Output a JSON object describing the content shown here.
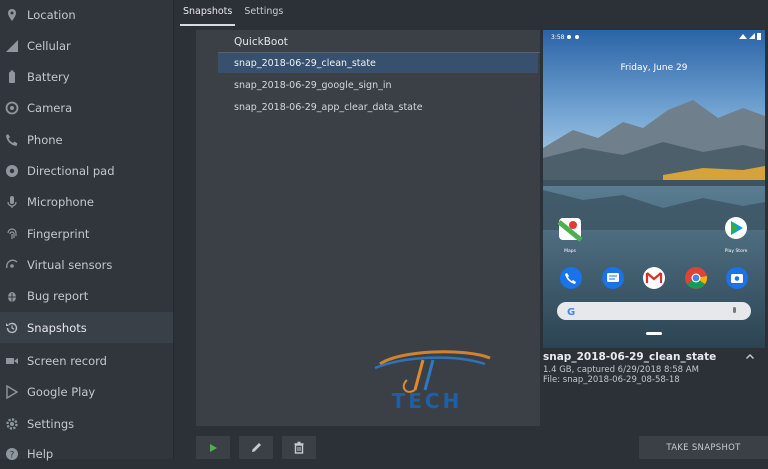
{
  "sidebar": {
    "items": [
      {
        "label": "Location",
        "icon": "location-icon"
      },
      {
        "label": "Cellular",
        "icon": "signal-icon"
      },
      {
        "label": "Battery",
        "icon": "battery-icon"
      },
      {
        "label": "Camera",
        "icon": "camera-icon"
      },
      {
        "label": "Phone",
        "icon": "phone-icon"
      },
      {
        "label": "Directional pad",
        "icon": "dpad-icon"
      },
      {
        "label": "Microphone",
        "icon": "microphone-icon"
      },
      {
        "label": "Fingerprint",
        "icon": "fingerprint-icon"
      },
      {
        "label": "Virtual sensors",
        "icon": "sensors-icon"
      },
      {
        "label": "Bug report",
        "icon": "bug-icon"
      },
      {
        "label": "Snapshots",
        "icon": "history-icon",
        "selected": true
      },
      {
        "label": "Screen record",
        "icon": "video-icon"
      },
      {
        "label": "Google Play",
        "icon": "play-store-icon"
      },
      {
        "label": "Settings",
        "icon": "gear-icon"
      },
      {
        "label": "Help",
        "icon": "help-icon"
      }
    ]
  },
  "tabs": [
    {
      "label": "Snapshots",
      "active": true
    },
    {
      "label": "Settings",
      "active": false
    }
  ],
  "snapshot_list": {
    "header": "QuickBoot",
    "rows": [
      {
        "name": "snap_2018-06-29_clean_state",
        "selected": true
      },
      {
        "name": "snap_2018-06-29_google_sign_in",
        "selected": false
      },
      {
        "name": "snap_2018-06-29_app_clear_data_state",
        "selected": false
      }
    ]
  },
  "preview": {
    "status_time": "3:58",
    "date_text": "Friday, June 29",
    "apps": {
      "maps": "Maps",
      "play_store": "Play Store"
    },
    "search_letter": "G",
    "title": "snap_2018-06-29_clean_state",
    "meta_line1": "1.4 GB, captured 6/29/2018 8:58 AM",
    "meta_line2": "File: snap_2018-06-29_08-58-18"
  },
  "toolbar": {
    "play_icon": "play-icon",
    "edit_icon": "pencil-icon",
    "delete_icon": "trash-icon",
    "take_snapshot_label": "TAKE SNAPSHOT"
  },
  "watermark": {
    "text": "TECH"
  },
  "colors": {
    "selection": "#36506d",
    "accent_green": "#4caf50",
    "background": "#2b3137"
  }
}
